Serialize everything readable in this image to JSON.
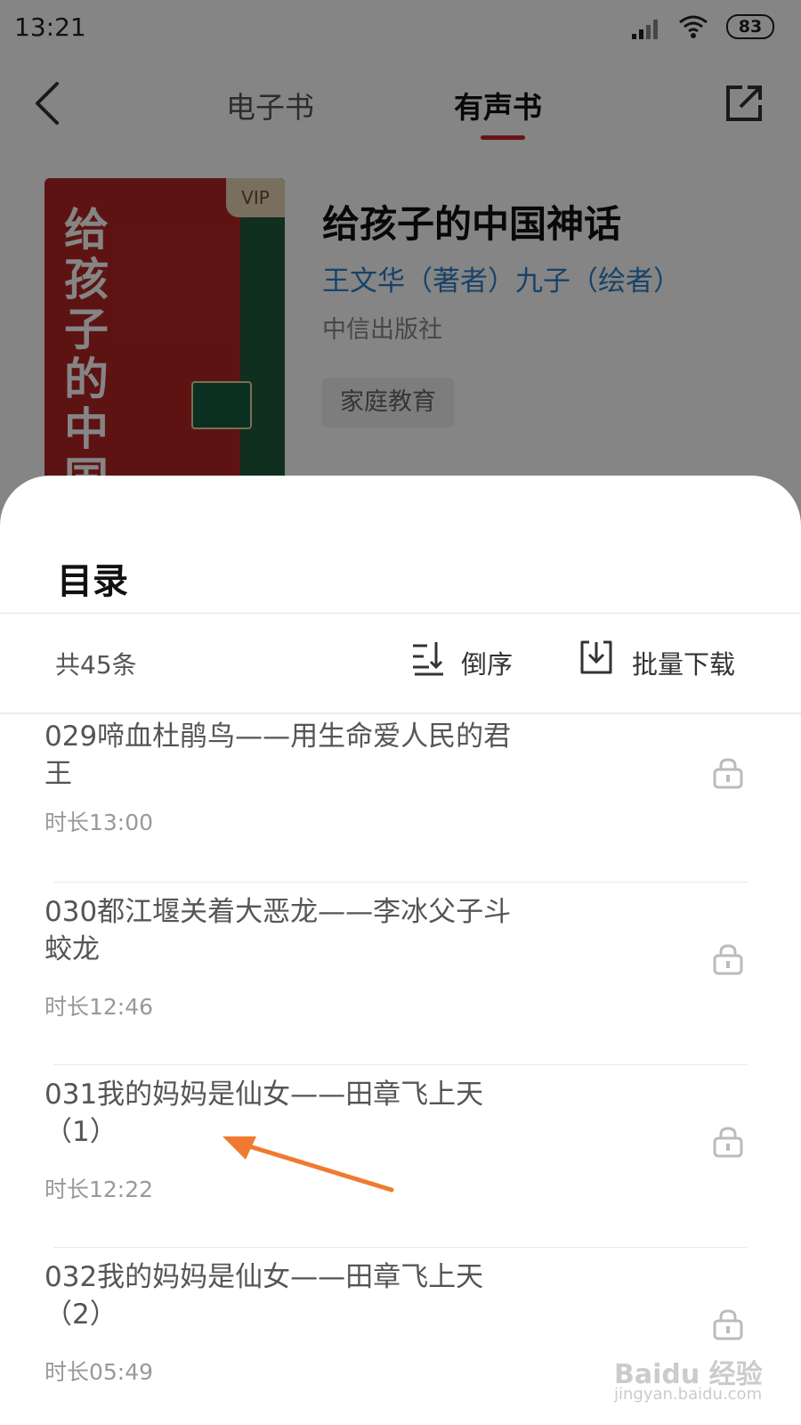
{
  "status_bar": {
    "time": "13:21",
    "battery": "83"
  },
  "nav": {
    "tab_ebook": "电子书",
    "tab_audio": "有声书",
    "active_tab": "有声书"
  },
  "book": {
    "cover_badge": "VIP",
    "cover_title": "给孩子的中国神话",
    "title": "给孩子的中国神话",
    "authors": "王文华（著者）九子（绘者）",
    "publisher": "中信出版社",
    "tag": "家庭教育"
  },
  "catalog": {
    "title": "目录",
    "count": "共45条",
    "sort_label": "倒序",
    "batch_download_label": "批量下载",
    "chapters": [
      {
        "title": "029啼血杜鹃鸟——用生命爱人民的君王",
        "duration": "时长13:00",
        "locked": true
      },
      {
        "title": "030都江堰关着大恶龙——李冰父子斗蛟龙",
        "duration": "时长12:46",
        "locked": true
      },
      {
        "title": "031我的妈妈是仙女——田章飞上天（1）",
        "duration": "时长12:22",
        "locked": true
      },
      {
        "title": "032我的妈妈是仙女——田章飞上天（2）",
        "duration": "时长05:49",
        "locked": true
      }
    ]
  },
  "watermark": {
    "brand": "Baidu 经验",
    "url": "jingyan.baidu.com"
  },
  "colors": {
    "accent": "#c8282f",
    "author_link": "#2f7fc8",
    "arrow": "#f07a30"
  }
}
